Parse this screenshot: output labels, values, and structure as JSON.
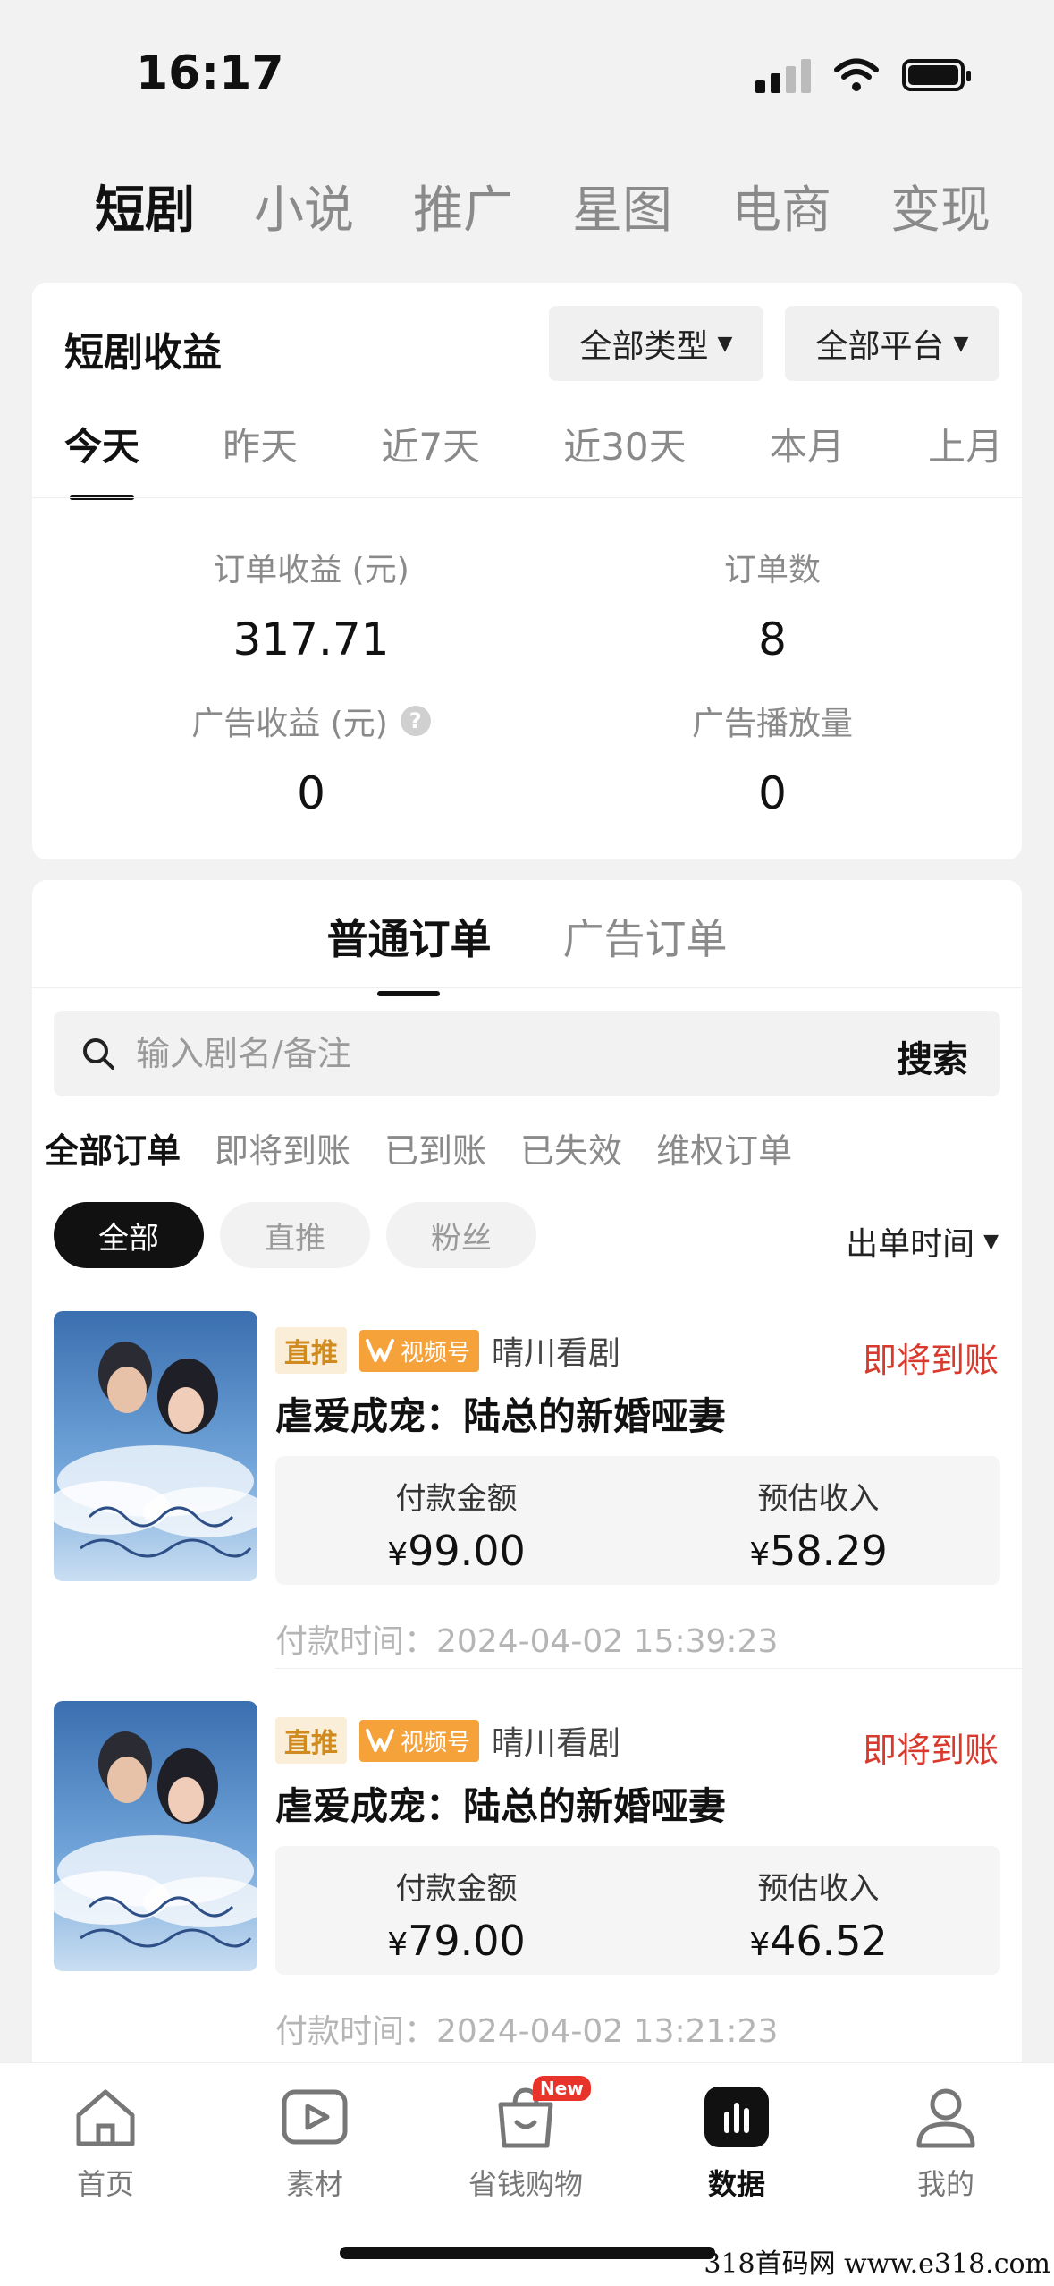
{
  "status_bar": {
    "time": "16:17"
  },
  "top_tabs": [
    "短剧",
    "小说",
    "推广",
    "星图",
    "电商",
    "变现"
  ],
  "earnings": {
    "title": "短剧收益",
    "filter_type": "全部类型",
    "filter_platform": "全部平台",
    "periods": [
      "今天",
      "昨天",
      "近7天",
      "近30天",
      "本月",
      "上月"
    ],
    "metrics": {
      "order_income_label": "订单收益 (元)",
      "order_income_value": "317.71",
      "order_count_label": "订单数",
      "order_count_value": "8",
      "ad_income_label": "广告收益 (元)",
      "ad_income_value": "0",
      "ad_plays_label": "广告播放量",
      "ad_plays_value": "0"
    }
  },
  "orders": {
    "type_tabs": [
      "普通订单",
      "广告订单"
    ],
    "search": {
      "placeholder": "输入剧名/备注",
      "button": "搜索"
    },
    "status_filters": [
      "全部订单",
      "即将到账",
      "已到账",
      "已失效",
      "维权订单"
    ],
    "chips": [
      "全部",
      "直推",
      "粉丝"
    ],
    "sort_label": "出单时间",
    "items": [
      {
        "badge": "直推",
        "channel": "视频号",
        "account": "晴川看剧",
        "status": "即将到账",
        "title": "虐爱成宠：陆总的新婚哑妻",
        "pay_label": "付款金额",
        "pay_value": "99.00",
        "income_label": "预估收入",
        "income_value": "58.29",
        "pay_time": "付款时间：2024-04-02 15:39:23"
      },
      {
        "badge": "直推",
        "channel": "视频号",
        "account": "晴川看剧",
        "status": "即将到账",
        "title": "虐爱成宠：陆总的新婚哑妻",
        "pay_label": "付款金额",
        "pay_value": "79.00",
        "income_label": "预估收入",
        "income_value": "46.52",
        "pay_time": "付款时间：2024-04-02 13:21:23"
      }
    ],
    "currency_symbol": "¥"
  },
  "bottom_nav": {
    "items": [
      "首页",
      "素材",
      "省钱购物",
      "数据",
      "我的"
    ],
    "new_badge": "New"
  },
  "watermark": "318首码网 www.e318.com",
  "colors": {
    "accent_red": "#d93a2e",
    "badge_orange": "#f5a23a",
    "active": "#111111"
  }
}
